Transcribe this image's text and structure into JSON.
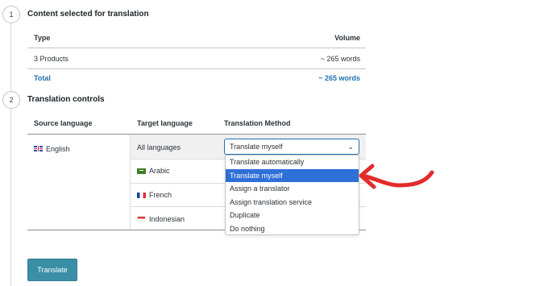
{
  "steps": [
    {
      "number": "1",
      "title": "Content selected for translation"
    },
    {
      "number": "2",
      "title": "Translation controls"
    }
  ],
  "content_table": {
    "headers": {
      "type": "Type",
      "volume": "Volume"
    },
    "rows": [
      {
        "type": "3 Products",
        "volume": "~ 265 words"
      }
    ],
    "total": {
      "label": "Total",
      "volume": "~ 265 words"
    }
  },
  "controls_table": {
    "headers": {
      "source": "Source language",
      "target": "Target language",
      "method": "Translation Method"
    },
    "source_language": {
      "label": "English",
      "flag": "uk-flag"
    },
    "all_languages_label": "All languages",
    "targets": [
      {
        "label": "Arabic",
        "flag": "arabic-flag"
      },
      {
        "label": "French",
        "flag": "french-flag"
      },
      {
        "label": "Indonesian",
        "flag": "indonesian-flag"
      }
    ],
    "method_select": {
      "value": "Translate myself",
      "options": [
        "Translate automatically",
        "Translate myself",
        "Assign a translator",
        "Assign translation service",
        "Duplicate",
        "Do nothing"
      ],
      "selected_index": 1
    }
  },
  "translate_button": "Translate",
  "colors": {
    "accent": "#2271b1",
    "button": "#3a8fa6",
    "highlight": "#2e6fd8",
    "annotation_arrow": "#e32b2b"
  }
}
